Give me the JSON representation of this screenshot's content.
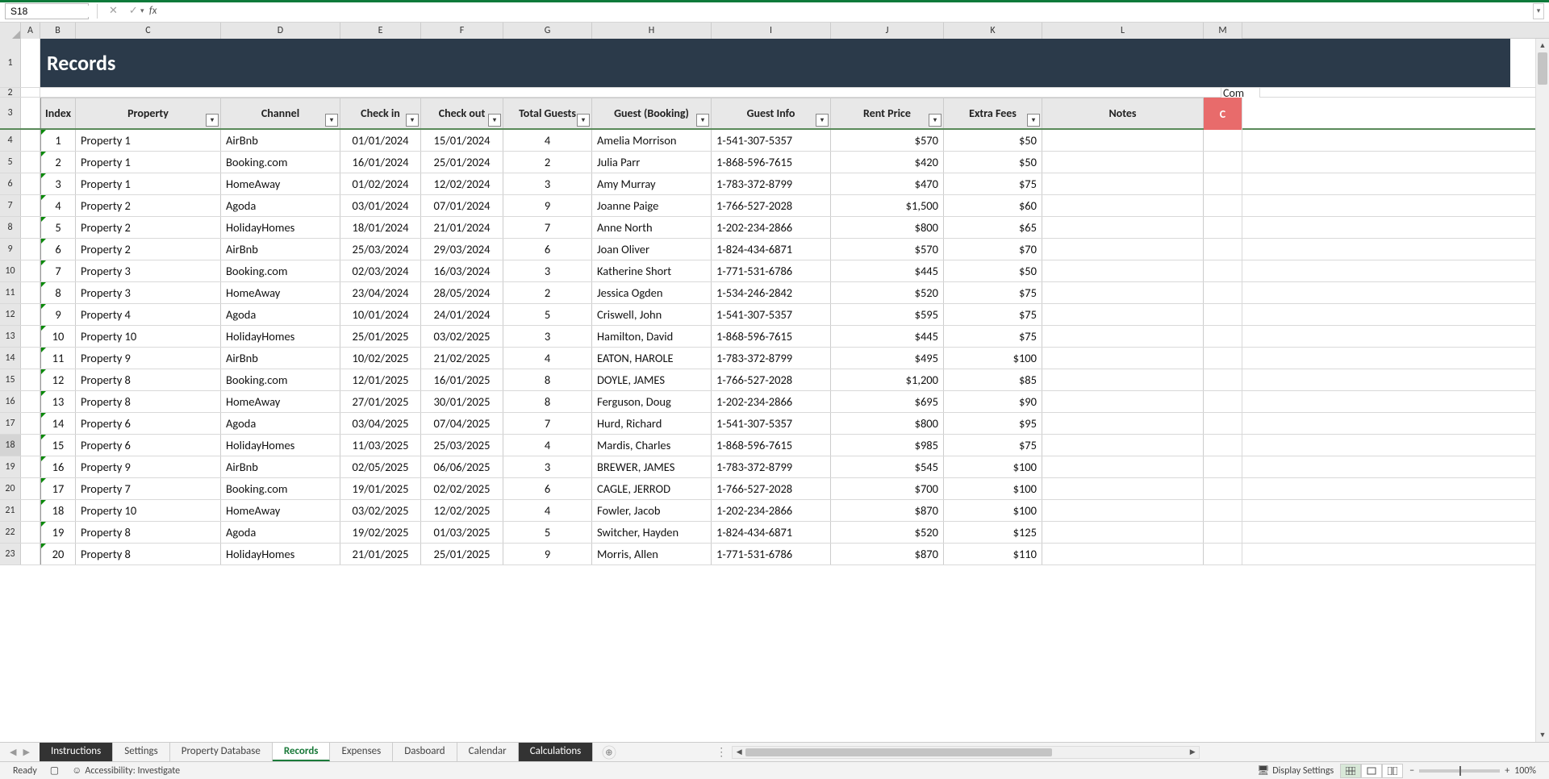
{
  "nameBox": "S18",
  "formulaBar": "",
  "colLetters": [
    "A",
    "B",
    "C",
    "D",
    "E",
    "F",
    "G",
    "H",
    "I",
    "J",
    "K",
    "L",
    "M"
  ],
  "bannerTitle": "Records",
  "overflowTopText": "Com",
  "overflowRedText": "C",
  "headers": {
    "index": "Index",
    "property": "Property",
    "channel": "Channel",
    "checkin": "Check in",
    "checkout": "Check out",
    "totalGuests": "Total Guests",
    "guestBooking": "Guest (Booking)",
    "guestInfo": "Guest Info",
    "rentPrice": "Rent Price",
    "extraFees": "Extra Fees",
    "notes": "Notes"
  },
  "rows": [
    {
      "n": 4,
      "idx": "1",
      "prop": "Property 1",
      "ch": "AirBnb",
      "ci": "01/01/2024",
      "co": "15/01/2024",
      "tg": "4",
      "gb": "Amelia Morrison",
      "gi": "1-541-307-5357",
      "rp": "$570",
      "ef": "$50",
      "notes": ""
    },
    {
      "n": 5,
      "idx": "2",
      "prop": "Property 1",
      "ch": "Booking.com",
      "ci": "16/01/2024",
      "co": "25/01/2024",
      "tg": "2",
      "gb": "Julia Parr",
      "gi": "1-868-596-7615",
      "rp": "$420",
      "ef": "$50",
      "notes": ""
    },
    {
      "n": 6,
      "idx": "3",
      "prop": "Property 1",
      "ch": "HomeAway",
      "ci": "01/02/2024",
      "co": "12/02/2024",
      "tg": "3",
      "gb": "Amy Murray",
      "gi": "1-783-372-8799",
      "rp": "$470",
      "ef": "$75",
      "notes": ""
    },
    {
      "n": 7,
      "idx": "4",
      "prop": "Property 2",
      "ch": "Agoda",
      "ci": "03/01/2024",
      "co": "07/01/2024",
      "tg": "9",
      "gb": "Joanne Paige",
      "gi": "1-766-527-2028",
      "rp": "$1,500",
      "ef": "$60",
      "notes": ""
    },
    {
      "n": 8,
      "idx": "5",
      "prop": "Property 2",
      "ch": "HolidayHomes",
      "ci": "18/01/2024",
      "co": "21/01/2024",
      "tg": "7",
      "gb": "Anne North",
      "gi": "1-202-234-2866",
      "rp": "$800",
      "ef": "$65",
      "notes": ""
    },
    {
      "n": 9,
      "idx": "6",
      "prop": "Property 2",
      "ch": "AirBnb",
      "ci": "25/03/2024",
      "co": "29/03/2024",
      "tg": "6",
      "gb": "Joan Oliver",
      "gi": "1-824-434-6871",
      "rp": "$570",
      "ef": "$70",
      "notes": ""
    },
    {
      "n": 10,
      "idx": "7",
      "prop": "Property 3",
      "ch": "Booking.com",
      "ci": "02/03/2024",
      "co": "16/03/2024",
      "tg": "3",
      "gb": "Katherine Short",
      "gi": "1-771-531-6786",
      "rp": "$445",
      "ef": "$50",
      "notes": ""
    },
    {
      "n": 11,
      "idx": "8",
      "prop": "Property 3",
      "ch": "HomeAway",
      "ci": "23/04/2024",
      "co": "28/05/2024",
      "tg": "2",
      "gb": "Jessica Ogden",
      "gi": "1-534-246-2842",
      "rp": "$520",
      "ef": "$75",
      "notes": ""
    },
    {
      "n": 12,
      "idx": "9",
      "prop": "Property 4",
      "ch": "Agoda",
      "ci": "10/01/2024",
      "co": "24/01/2024",
      "tg": "5",
      "gb": "Criswell, John",
      "gi": "1-541-307-5357",
      "rp": "$595",
      "ef": "$75",
      "notes": ""
    },
    {
      "n": 13,
      "idx": "10",
      "prop": "Property 10",
      "ch": "HolidayHomes",
      "ci": "25/01/2025",
      "co": "03/02/2025",
      "tg": "3",
      "gb": "Hamilton, David",
      "gi": "1-868-596-7615",
      "rp": "$445",
      "ef": "$75",
      "notes": ""
    },
    {
      "n": 14,
      "idx": "11",
      "prop": "Property 9",
      "ch": "AirBnb",
      "ci": "10/02/2025",
      "co": "21/02/2025",
      "tg": "4",
      "gb": "EATON, HAROLE",
      "gi": "1-783-372-8799",
      "rp": "$495",
      "ef": "$100",
      "notes": ""
    },
    {
      "n": 15,
      "idx": "12",
      "prop": "Property 8",
      "ch": "Booking.com",
      "ci": "12/01/2025",
      "co": "16/01/2025",
      "tg": "8",
      "gb": "DOYLE, JAMES",
      "gi": "1-766-527-2028",
      "rp": "$1,200",
      "ef": "$85",
      "notes": ""
    },
    {
      "n": 16,
      "idx": "13",
      "prop": "Property 8",
      "ch": "HomeAway",
      "ci": "27/01/2025",
      "co": "30/01/2025",
      "tg": "8",
      "gb": "Ferguson, Doug",
      "gi": "1-202-234-2866",
      "rp": "$695",
      "ef": "$90",
      "notes": ""
    },
    {
      "n": 17,
      "idx": "14",
      "prop": "Property 6",
      "ch": "Agoda",
      "ci": "03/04/2025",
      "co": "07/04/2025",
      "tg": "7",
      "gb": "Hurd, Richard",
      "gi": "1-541-307-5357",
      "rp": "$800",
      "ef": "$95",
      "notes": ""
    },
    {
      "n": 18,
      "idx": "15",
      "prop": "Property 6",
      "ch": "HolidayHomes",
      "ci": "11/03/2025",
      "co": "25/03/2025",
      "tg": "4",
      "gb": "Mardis, Charles",
      "gi": "1-868-596-7615",
      "rp": "$985",
      "ef": "$75",
      "notes": ""
    },
    {
      "n": 19,
      "idx": "16",
      "prop": "Property 9",
      "ch": "AirBnb",
      "ci": "02/05/2025",
      "co": "06/06/2025",
      "tg": "3",
      "gb": "BREWER, JAMES",
      "gi": "1-783-372-8799",
      "rp": "$545",
      "ef": "$100",
      "notes": ""
    },
    {
      "n": 20,
      "idx": "17",
      "prop": "Property 7",
      "ch": "Booking.com",
      "ci": "19/01/2025",
      "co": "02/02/2025",
      "tg": "6",
      "gb": "CAGLE, JERROD",
      "gi": "1-766-527-2028",
      "rp": "$700",
      "ef": "$100",
      "notes": ""
    },
    {
      "n": 21,
      "idx": "18",
      "prop": "Property 10",
      "ch": "HomeAway",
      "ci": "03/02/2025",
      "co": "12/02/2025",
      "tg": "4",
      "gb": "Fowler, Jacob",
      "gi": "1-202-234-2866",
      "rp": "$870",
      "ef": "$100",
      "notes": ""
    },
    {
      "n": 22,
      "idx": "19",
      "prop": "Property 8",
      "ch": "Agoda",
      "ci": "19/02/2025",
      "co": "01/03/2025",
      "tg": "5",
      "gb": "Switcher, Hayden",
      "gi": "1-824-434-6871",
      "rp": "$520",
      "ef": "$125",
      "notes": ""
    },
    {
      "n": 23,
      "idx": "20",
      "prop": "Property 8",
      "ch": "HolidayHomes",
      "ci": "21/01/2025",
      "co": "25/01/2025",
      "tg": "9",
      "gb": "Morris, Allen",
      "gi": "1-771-531-6786",
      "rp": "$870",
      "ef": "$110",
      "notes": ""
    }
  ],
  "tabs": [
    {
      "label": "Instructions",
      "style": "dark"
    },
    {
      "label": "Settings",
      "style": "normal"
    },
    {
      "label": "Property Database",
      "style": "normal"
    },
    {
      "label": "Records",
      "style": "active"
    },
    {
      "label": "Expenses",
      "style": "normal"
    },
    {
      "label": "Dasboard",
      "style": "normal"
    },
    {
      "label": "Calendar",
      "style": "normal"
    },
    {
      "label": "Calculations",
      "style": "dark"
    }
  ],
  "status": {
    "ready": "Ready",
    "accessibility": "Accessibility: Investigate",
    "displaySettings": "Display Settings",
    "zoom": "100%"
  }
}
